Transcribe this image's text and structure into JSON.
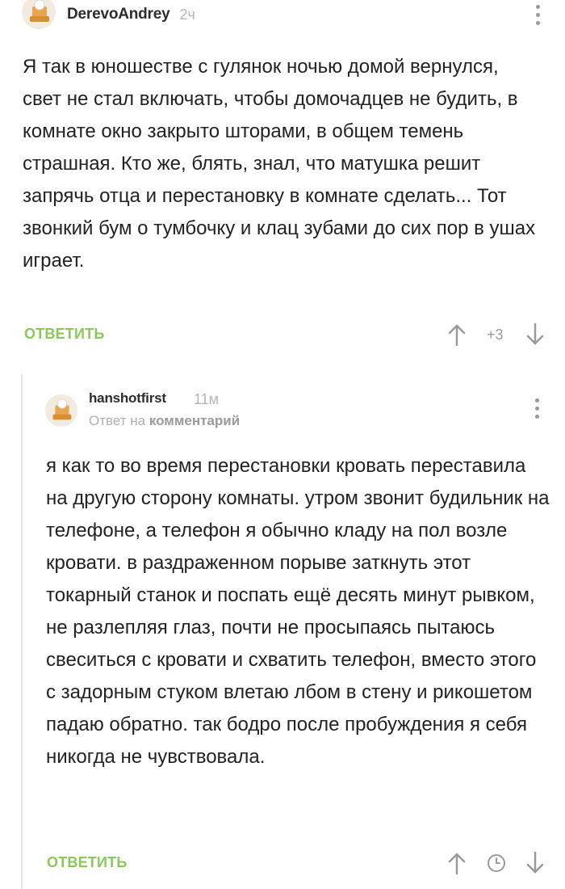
{
  "comments": [
    {
      "author": "DerevoAndrey",
      "time": "2ч",
      "text": "Я так в юношестве с гулянок ночью домой вернулся, свет не стал включать, чтобы домочадцев не будить, в комнате окно закрыто шторами, в общем темень страшная. Кто же, блять, знал, что матушка решит запрячь отца и перестановку в комнате сделать... Тот звонкий бум о тумбочку и клац зубами до сих пор в ушах играет.",
      "reply_label": "ОТВЕТИТЬ",
      "rating": "+3"
    },
    {
      "author": "hanshotfirst",
      "time": "11м",
      "reply_prefix": "Ответ на",
      "reply_target": "комментарий",
      "text": "я как то во время перестановки кровать переставила на другую сторону комнаты. утром звонит будильник на телефоне, а телефон я обычно кладу на пол возле кровати. в раздраженном порыве заткнуть этот токарный станок и поспать ещё десять минут рывком, не разлепляя глаз, почти не просыпаясь пытаюсь свеситься с кровати и схватить телефон, вместо этого с задорным стуком влетаю лбом в стену и рикошетом падаю обратно. так бодро после пробуждения я себя никогда не чувствовала.",
      "reply_label": "ОТВЕТИТЬ"
    }
  ],
  "colors": {
    "reply_green": "#8ac858",
    "muted": "#9a9a9a",
    "text": "#222222"
  },
  "icons": {
    "more": "more-vertical-icon",
    "upvote": "arrow-up-icon",
    "downvote": "arrow-down-icon",
    "clock": "clock-icon",
    "avatar": "avatar-icon"
  }
}
